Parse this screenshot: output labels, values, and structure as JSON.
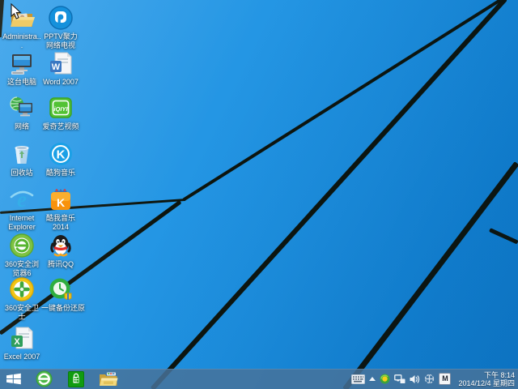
{
  "desktop": {
    "icons": [
      {
        "name": "user-folder",
        "label": "Administra..."
      },
      {
        "name": "pptv",
        "label": "PPTV聚力 网络电视"
      },
      {
        "name": "this-pc",
        "label": "这台电脑"
      },
      {
        "name": "word-2007",
        "label": "Word 2007"
      },
      {
        "name": "network",
        "label": "网络"
      },
      {
        "name": "iqiyi",
        "label": "爱奇艺视频"
      },
      {
        "name": "recycle-bin",
        "label": "回收站"
      },
      {
        "name": "kugou-music",
        "label": "酷狗音乐"
      },
      {
        "name": "internet-explorer",
        "label": "Internet Explorer"
      },
      {
        "name": "kuwo-music",
        "label": "酷我音乐 2014"
      },
      {
        "name": "360-browser",
        "label": "360安全浏览器6"
      },
      {
        "name": "tencent-qq",
        "label": "腾讯QQ"
      },
      {
        "name": "360-safe-guard",
        "label": "360安全卫士"
      },
      {
        "name": "one-key-backup",
        "label": "一键备份还原"
      },
      {
        "name": "excel-2007",
        "label": "Excel 2007"
      }
    ]
  },
  "taskbar": {
    "buttons": [
      {
        "name": "start-button",
        "icon": "windows-logo-icon"
      },
      {
        "name": "360-browser-taskbar-button",
        "icon": "360-browser-icon"
      },
      {
        "name": "windows-store-taskbar-button",
        "icon": "store-icon"
      },
      {
        "name": "file-explorer-taskbar-button",
        "icon": "folder-icon"
      }
    ],
    "tray": {
      "icons": [
        "touch-keyboard-icon",
        "show-hidden-icons-chevron",
        "360-tray-icon",
        "network-tray-icon",
        "volume-icon",
        "globe-cross-icon",
        "ime-indicator"
      ],
      "ime_label": "M",
      "time": "下午 8:14",
      "date": "2014/12/4 星期四"
    }
  },
  "colors": {
    "wallpaper_blue": "#1e90e0",
    "beam_dark": "#0d150e",
    "taskbar_blue": "#48729a",
    "label_text": "#ffffff"
  }
}
